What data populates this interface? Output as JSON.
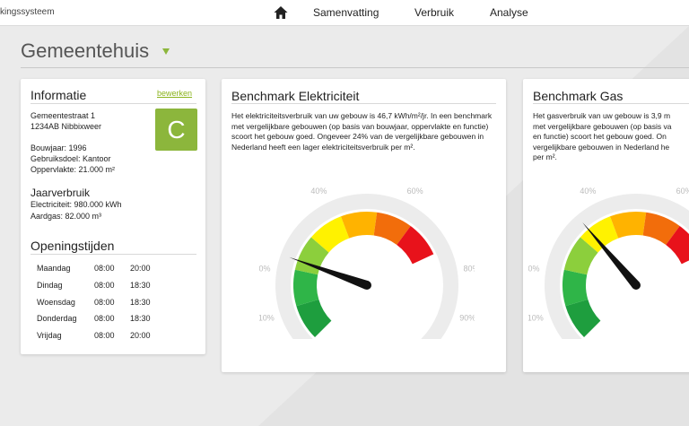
{
  "header": {
    "brand": "kingssysteem",
    "nav": [
      "Samenvatting",
      "Verbruik",
      "Analyse"
    ]
  },
  "page": {
    "title": "Gemeentehuis"
  },
  "info": {
    "title": "Informatie",
    "edit": "bewerken",
    "address_line1": "Gemeentestraat 1",
    "address_line2": "1234AB Nibbixweer",
    "bouwjaar": "Bouwjaar: 1996",
    "gebruiksdoel": "Gebruiksdoel: Kantoor",
    "oppervlakte": "Oppervlakte: 21.000 m²",
    "energy_label": "C",
    "jaarverbruik_title": "Jaarverbruik",
    "electriciteit": "Electriciteit: 980.000 kWh",
    "aardgas": "Aardgas: 82.000 m³",
    "openingstijden_title": "Openingstijden",
    "hours": [
      {
        "day": "Maandag",
        "open": "08:00",
        "close": "20:00"
      },
      {
        "day": "Dindag",
        "open": "08:00",
        "close": "18:30"
      },
      {
        "day": "Woensdag",
        "open": "08:00",
        "close": "18:30"
      },
      {
        "day": "Donderdag",
        "open": "08:00",
        "close": "18:30"
      },
      {
        "day": "Vrijdag",
        "open": "08:00",
        "close": "20:00"
      }
    ]
  },
  "elec": {
    "title": "Benchmark Elektriciteit",
    "text": "Het elektriciteitsverbruik van uw gebouw is 46,7 kWh/m²/jr. In een benchmark met vergelijkbare gebouwen (op basis van bouwjaar, oppervlakte en functie) scoort het gebouw goed. Ongeveer 24% van de vergelijkbare gebouwen in Nederland heeft een lager elektriciteitsverbruik per m².",
    "needle_percent": 24
  },
  "gas": {
    "title": "Benchmark Gas",
    "text_lines": [
      "Het gasverbruik van uw gebouw is 3,9 m",
      "met vergelijkbare gebouwen (op basis va",
      "en functie) scoort het gebouw goed. On",
      "vergelijkbare gebouwen in Nederland he",
      "per m²."
    ],
    "needle_percent": 35
  },
  "gauge_ticks": [
    "0%",
    "10%",
    "20%",
    "40%",
    "60%",
    "80%",
    "90%",
    "100%"
  ],
  "colors": {
    "accent": "#8cb63c",
    "link": "#8bb31d",
    "zones": [
      "#1e9e3e",
      "#2fb548",
      "#8ccf3c",
      "#fff200",
      "#ffb300",
      "#f26d0b",
      "#e8121b"
    ]
  }
}
